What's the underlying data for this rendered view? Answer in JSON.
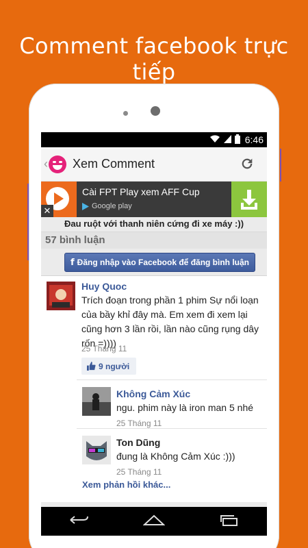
{
  "promo": {
    "title": "Comment facebook trực tiếp"
  },
  "status_bar": {
    "time": "6:46"
  },
  "app_bar": {
    "title": "Xem Comment"
  },
  "ad": {
    "text": "Cài FPT Play xem AFF Cup",
    "store": "Google play"
  },
  "post": {
    "title": "Đau ruột với thanh niên cứng đi xe máy :))",
    "comment_count": "57 bình luận"
  },
  "facebook_login": {
    "label": "Đăng nhập vào Facebook để đăng bình luận"
  },
  "comments": [
    {
      "author": "Huy Quoc",
      "text": "Trích đoạn trong phần 1 phim Sự nổi loạn của bầy khỉ đây mà. Em xem đi xem lại cũng hơn 3 lần rồi, lần nào cũng rụng dây rốn =))))",
      "date": "25 Tháng 11",
      "likes": "9 người",
      "replies": [
        {
          "author": "Không Cảm Xúc",
          "text": "ngu. phim này là iron man 5 nhé",
          "date": "25 Tháng 11"
        },
        {
          "author": "Ton Dũng",
          "text": "đung là Không Cảm Xúc :)))",
          "date": "25 Tháng 11"
        }
      ],
      "more_replies": "Xem phản hồi khác..."
    }
  ],
  "icons": {
    "wifi": "wifi-icon",
    "signal": "signal-icon",
    "battery": "battery-icon",
    "back": "back-icon",
    "home": "home-icon",
    "recents": "recents-icon",
    "refresh": "refresh-icon",
    "like": "thumbs-up-icon",
    "download": "download-icon"
  },
  "colors": {
    "background": "#e76a0e",
    "logo": "#e5227a",
    "facebook": "#3b5998",
    "ad_download": "#8cc63e"
  }
}
